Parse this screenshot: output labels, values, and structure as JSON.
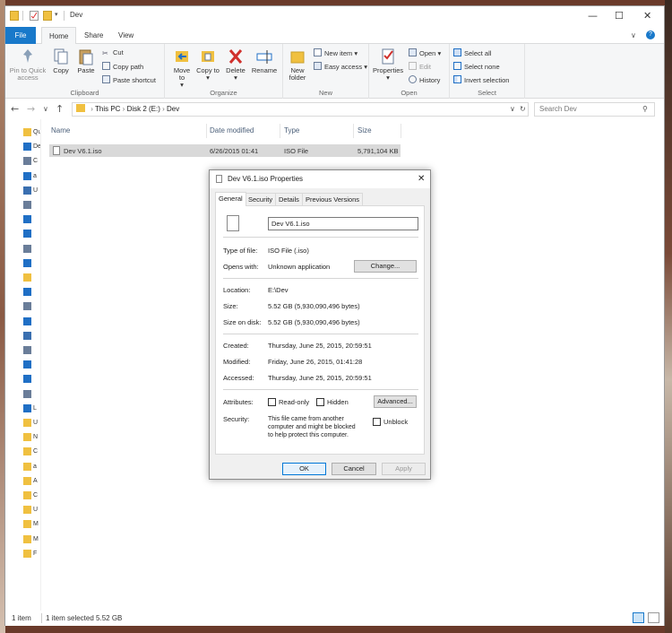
{
  "window": {
    "title": "Dev"
  },
  "title_controls": {
    "minimize": "—",
    "maximize": "☐",
    "close": "✕"
  },
  "tabs": {
    "file": "File",
    "home": "Home",
    "share": "Share",
    "view": "View"
  },
  "ribbon": {
    "clipboard": {
      "label": "Clipboard",
      "pin": "Pin to Quick access",
      "copy": "Copy",
      "paste": "Paste",
      "cut": "Cut",
      "copy_path": "Copy path",
      "paste_shortcut": "Paste shortcut"
    },
    "organize": {
      "label": "Organize",
      "move_to": "Move to",
      "copy_to": "Copy to",
      "delete": "Delete",
      "rename": "Rename"
    },
    "new": {
      "label": "New",
      "new_folder": "New folder",
      "new_item": "New item",
      "easy_access": "Easy access"
    },
    "open": {
      "label": "Open",
      "properties": "Properties",
      "open": "Open",
      "edit": "Edit",
      "history": "History"
    },
    "select": {
      "label": "Select",
      "select_all": "Select all",
      "select_none": "Select none",
      "invert": "Invert selection"
    }
  },
  "address": {
    "path": [
      "This PC",
      "Disk 2 (E:)",
      "Dev"
    ],
    "search_placeholder": "Search Dev"
  },
  "nav_pane": [
    "Qu",
    "De",
    "C",
    "a",
    "U",
    "",
    "",
    "",
    "",
    "",
    "",
    "",
    "",
    "",
    "",
    "",
    "",
    "",
    "",
    "L",
    "U",
    "N",
    "C",
    "a",
    "A",
    "C",
    "U",
    "M",
    "M",
    "F"
  ],
  "columns": [
    "Name",
    "Date modified",
    "Type",
    "Size"
  ],
  "files": [
    {
      "name": "Dev V6.1.iso",
      "date": "6/26/2015 01:41",
      "type": "ISO File",
      "size": "5,791,104 KB"
    }
  ],
  "status": {
    "count": "1 item",
    "selected": "1 item selected  5.52 GB"
  },
  "dialog": {
    "title": "Dev V6.1.iso Properties",
    "tabs": [
      "General",
      "Security",
      "Details",
      "Previous Versions"
    ],
    "filename": "Dev V6.1.iso",
    "type_label": "Type of file:",
    "type_value": "ISO File (.iso)",
    "opens_label": "Opens with:",
    "opens_value": "Unknown application",
    "change": "Change...",
    "location_label": "Location:",
    "location_value": "E:\\Dev",
    "size_label": "Size:",
    "size_value": "5.52 GB (5,930,090,496 bytes)",
    "disk_label": "Size on disk:",
    "disk_value": "5.52 GB (5,930,090,496 bytes)",
    "created_label": "Created:",
    "created_value": "Thursday, June 25, 2015, 20:59:51",
    "modified_label": "Modified:",
    "modified_value": "Friday, June 26, 2015, 01:41:28",
    "accessed_label": "Accessed:",
    "accessed_value": "Thursday, June 25, 2015, 20:59:51",
    "attributes_label": "Attributes:",
    "readonly": "Read-only",
    "hidden": "Hidden",
    "advanced": "Advanced...",
    "security_label": "Security:",
    "security_text": "This file came from another computer and might be blocked to help protect this computer.",
    "unblock": "Unblock",
    "ok": "OK",
    "cancel": "Cancel",
    "apply": "Apply"
  },
  "colors": {
    "accent": "#1979ca",
    "folder": "#f0c040",
    "selection": "#d9d9d9"
  }
}
